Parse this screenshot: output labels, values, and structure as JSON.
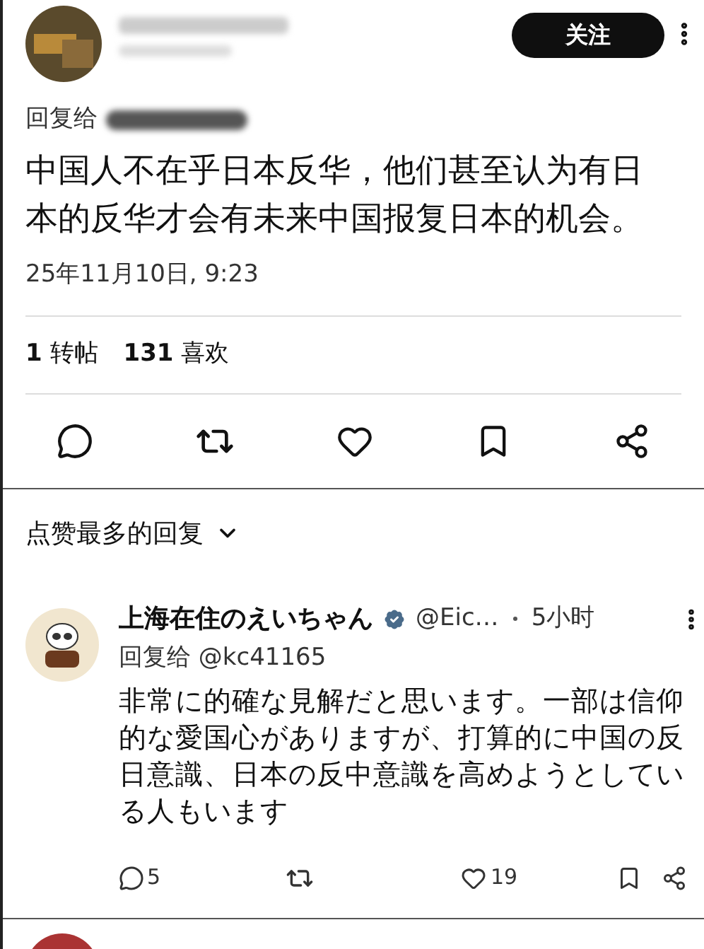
{
  "post": {
    "follow_button": "关注",
    "reply_to_prefix": "回复给",
    "text": "中国人不在乎日本反华，他们甚至认为有日本的反华才会有未来中国报复日本的机会。",
    "timestamp": "25年11月10日, 9:23",
    "stats": [
      {
        "count": "1",
        "label": "转帖"
      },
      {
        "count": "131",
        "label": "喜欢"
      }
    ]
  },
  "replies_header": {
    "label": "点赞最多的回复"
  },
  "reply": {
    "name": "上海在住のえいちゃん",
    "handle": "@Eic…",
    "time": "5小时",
    "reply_to": "回复给 @kc41165",
    "text": "非常に的確な見解だと思います。一部は信仰的な愛国心がありますが、打算的に中国の反日意識、日本の反中意識を高めようとしている人もいます",
    "reply_count": "5",
    "like_count": "19"
  }
}
